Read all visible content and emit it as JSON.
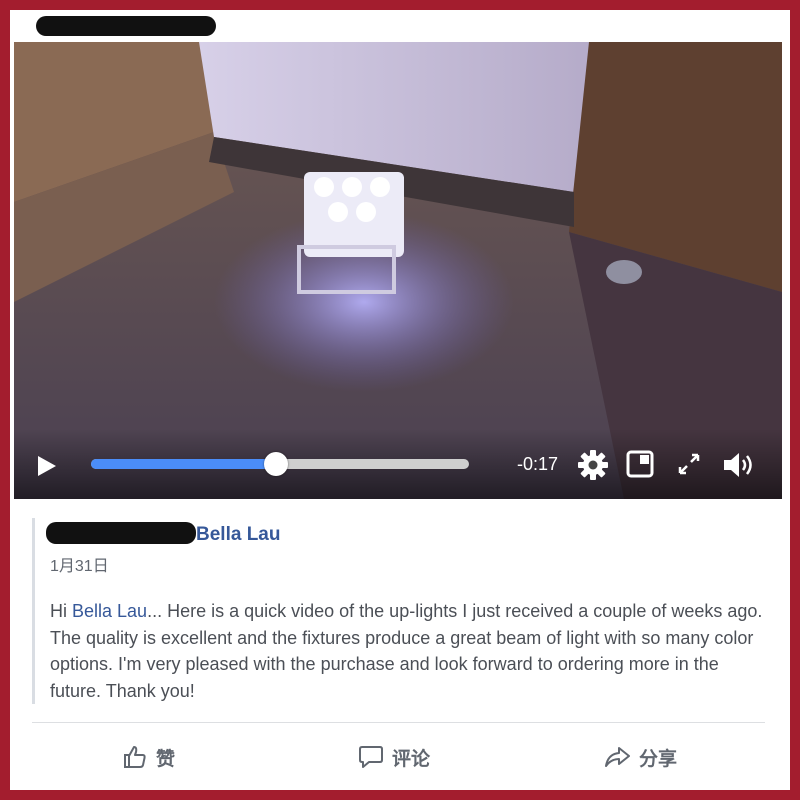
{
  "video": {
    "time_remaining": "-0:17",
    "progress": 0.49
  },
  "icons": {
    "play": "play-icon",
    "settings": "gear-icon",
    "pip": "picture-in-picture-icon",
    "fullscreen": "fullscreen-icon",
    "volume": "volume-icon",
    "like": "thumbs-up-icon",
    "comment": "comment-bubble-icon",
    "share": "share-arrow-icon"
  },
  "comment": {
    "author": "Bella Lau",
    "date": "1月31日",
    "text_prefix": "Hi ",
    "mention": "Bella Lau",
    "text_body": "... Here is a quick video of the up-lights I just received a couple of weeks ago. The quality is excellent and the fixtures produce a great beam of light with so many color options. I'm very pleased with the purchase and look forward to ordering more in the future. Thank you!"
  },
  "actions": {
    "like": "赞",
    "comment": "评论",
    "share": "分享"
  },
  "colors": {
    "frame": "#a31d2e",
    "progress_fill": "#4b8df8",
    "link": "#365899"
  }
}
